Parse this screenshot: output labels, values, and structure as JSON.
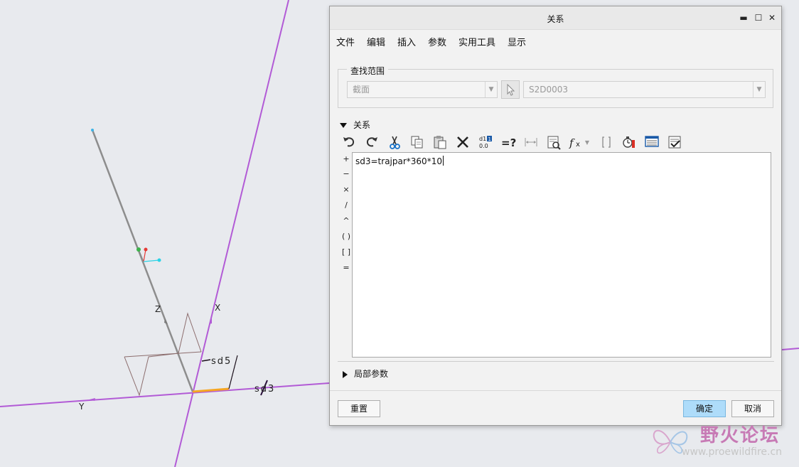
{
  "viewport": {
    "labels": {
      "z": "Z",
      "x": "X",
      "y": "Y",
      "sd5": "sd5",
      "sd3": "sd3"
    }
  },
  "dialog": {
    "title": "关系",
    "window_controls": {
      "minimize": "▬",
      "maximize": "☐",
      "close": "✕"
    },
    "menu": [
      "文件",
      "编辑",
      "插入",
      "参数",
      "实用工具",
      "显示"
    ],
    "search": {
      "legend": "查找范围",
      "scope_value": "截面",
      "object_value": "S2D0003"
    },
    "relations": {
      "header": "关系",
      "toolbar_icons": [
        "undo-icon",
        "redo-icon",
        "cut-icon",
        "copy-icon",
        "paste-icon",
        "delete-icon",
        "switch-dimensions-icon",
        "evaluate-icon",
        "insert-dimension-icon",
        "insert-parameter-icon",
        "insert-function-icon",
        "insert-brackets-icon",
        "verify-icon",
        "sort-icon",
        "execute-icon"
      ],
      "operators": [
        "+",
        "−",
        "×",
        "/",
        "^",
        "( )",
        "[ ]",
        "="
      ],
      "text": "sd3=trajpar*360*10"
    },
    "local_params_header": "局部参数",
    "buttons": {
      "reset": "重置",
      "ok": "确定",
      "cancel": "取消"
    }
  },
  "watermark": {
    "title": "野火论坛",
    "url": "www.proewildfire.cn"
  },
  "colors": {
    "datum_plane": "#b25bd6",
    "trajectory": "#8d8d8d",
    "highlight": "#f5a623",
    "ok_button": "#aedcfa"
  }
}
